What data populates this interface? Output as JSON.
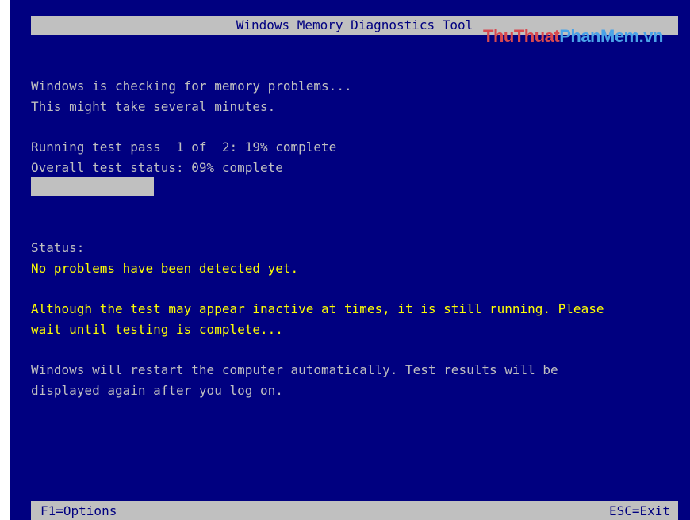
{
  "title": "Windows Memory Diagnostics Tool",
  "watermark": {
    "part1": "ThuThuat",
    "part2": "PhanMem.vn"
  },
  "intro": {
    "line1": "Windows is checking for memory problems...",
    "line2": "This might take several minutes."
  },
  "progress": {
    "pass_line": "Running test pass  1 of  2: 19% complete",
    "overall_line": "Overall test status: 09% complete",
    "overall_fraction": 0.19
  },
  "status": {
    "label": "Status:",
    "message": "No problems have been detected yet."
  },
  "notice": {
    "line1": "Although the test may appear inactive at times, it is still running. Please",
    "line2": "wait until testing is complete..."
  },
  "restart": {
    "line1": "Windows will restart the computer automatically. Test results will be",
    "line2": "displayed again after you log on."
  },
  "footer": {
    "options": "F1=Options",
    "exit": "ESC=Exit"
  },
  "colors": {
    "background": "#000080",
    "bar": "#c0c0c0",
    "text": "#c0c0c0",
    "highlight": "#ffff00"
  }
}
